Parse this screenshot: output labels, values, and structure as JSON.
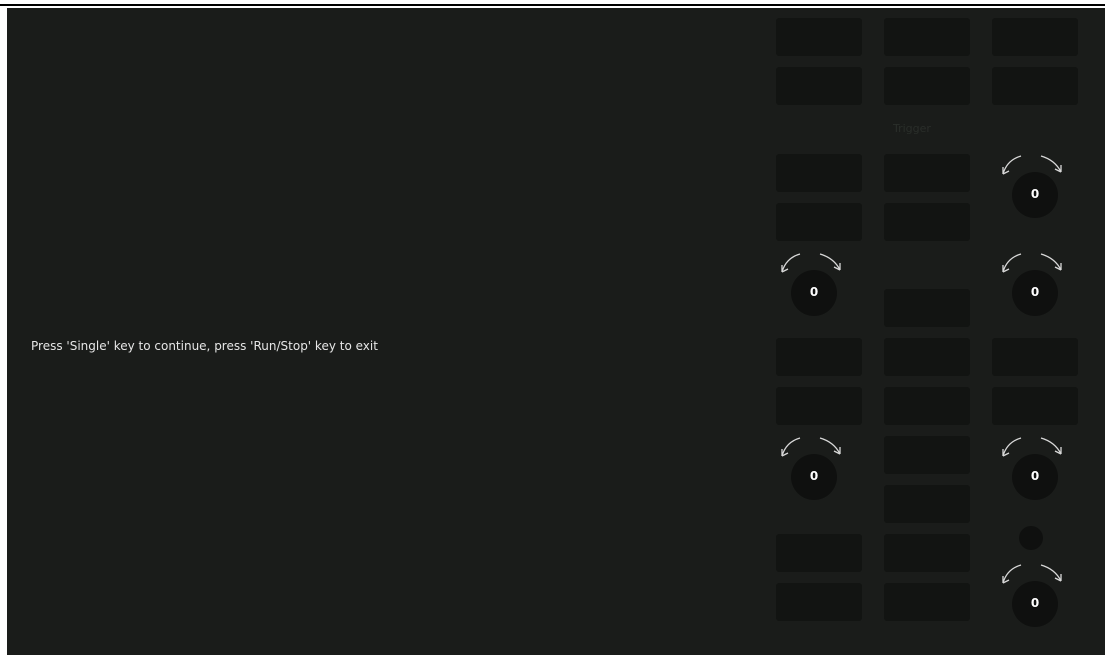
{
  "screen": {
    "message": "Press 'Single' key to continue, press 'Run/Stop' key to exit"
  },
  "panel": {
    "trigger_label": "Trigger",
    "knobs": [
      {
        "id": "knob-1",
        "value": "0"
      },
      {
        "id": "knob-2",
        "value": "0"
      },
      {
        "id": "knob-3",
        "value": "0"
      },
      {
        "id": "knob-4",
        "value": "0"
      },
      {
        "id": "knob-5",
        "value": "0"
      },
      {
        "id": "knob-6",
        "value": "0"
      }
    ],
    "button_count": 23,
    "colors": {
      "background": "#1a1c1a",
      "key": "#121412",
      "text": "#e6e6e6"
    }
  }
}
